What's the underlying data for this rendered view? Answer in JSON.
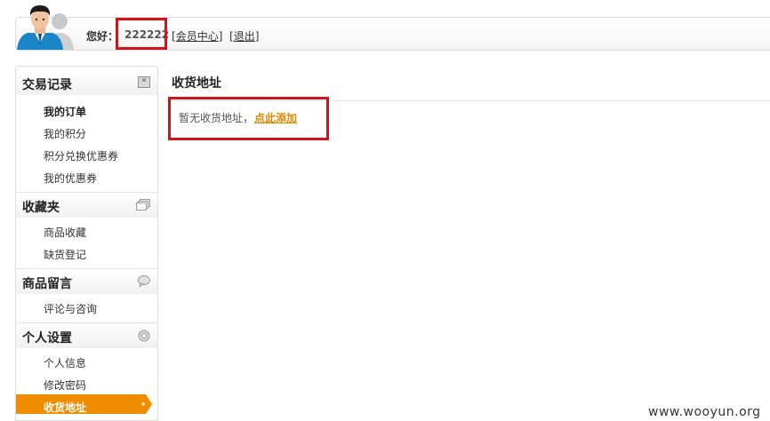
{
  "header": {
    "greeting": "您好：",
    "username": "222222",
    "member_center_link": "会员中心",
    "logout_link": "退出"
  },
  "sidebar": {
    "sections": [
      {
        "title": "交易记录",
        "icon": "box-icon",
        "items": [
          "我的订单",
          "我的积分",
          "积分兑换优惠券",
          "我的优惠券"
        ]
      },
      {
        "title": "收藏夹",
        "icon": "stack-icon",
        "items": [
          "商品收藏",
          "缺货登记"
        ]
      },
      {
        "title": "商品留言",
        "icon": "speech-bubble-icon",
        "items": [
          "评论与咨询"
        ]
      },
      {
        "title": "个人设置",
        "icon": "gear-icon",
        "items": [
          "个人信息",
          "修改密码",
          "收货地址"
        ]
      }
    ],
    "active_item": "收货地址"
  },
  "main": {
    "title": "收货地址",
    "empty_message": "暂无收货地址，",
    "add_link": "点此添加"
  },
  "watermark": "www.wooyun.org",
  "colors": {
    "highlight_border": "#d0141c",
    "active_tab": "#f08c00",
    "add_link": "#e08a00"
  }
}
